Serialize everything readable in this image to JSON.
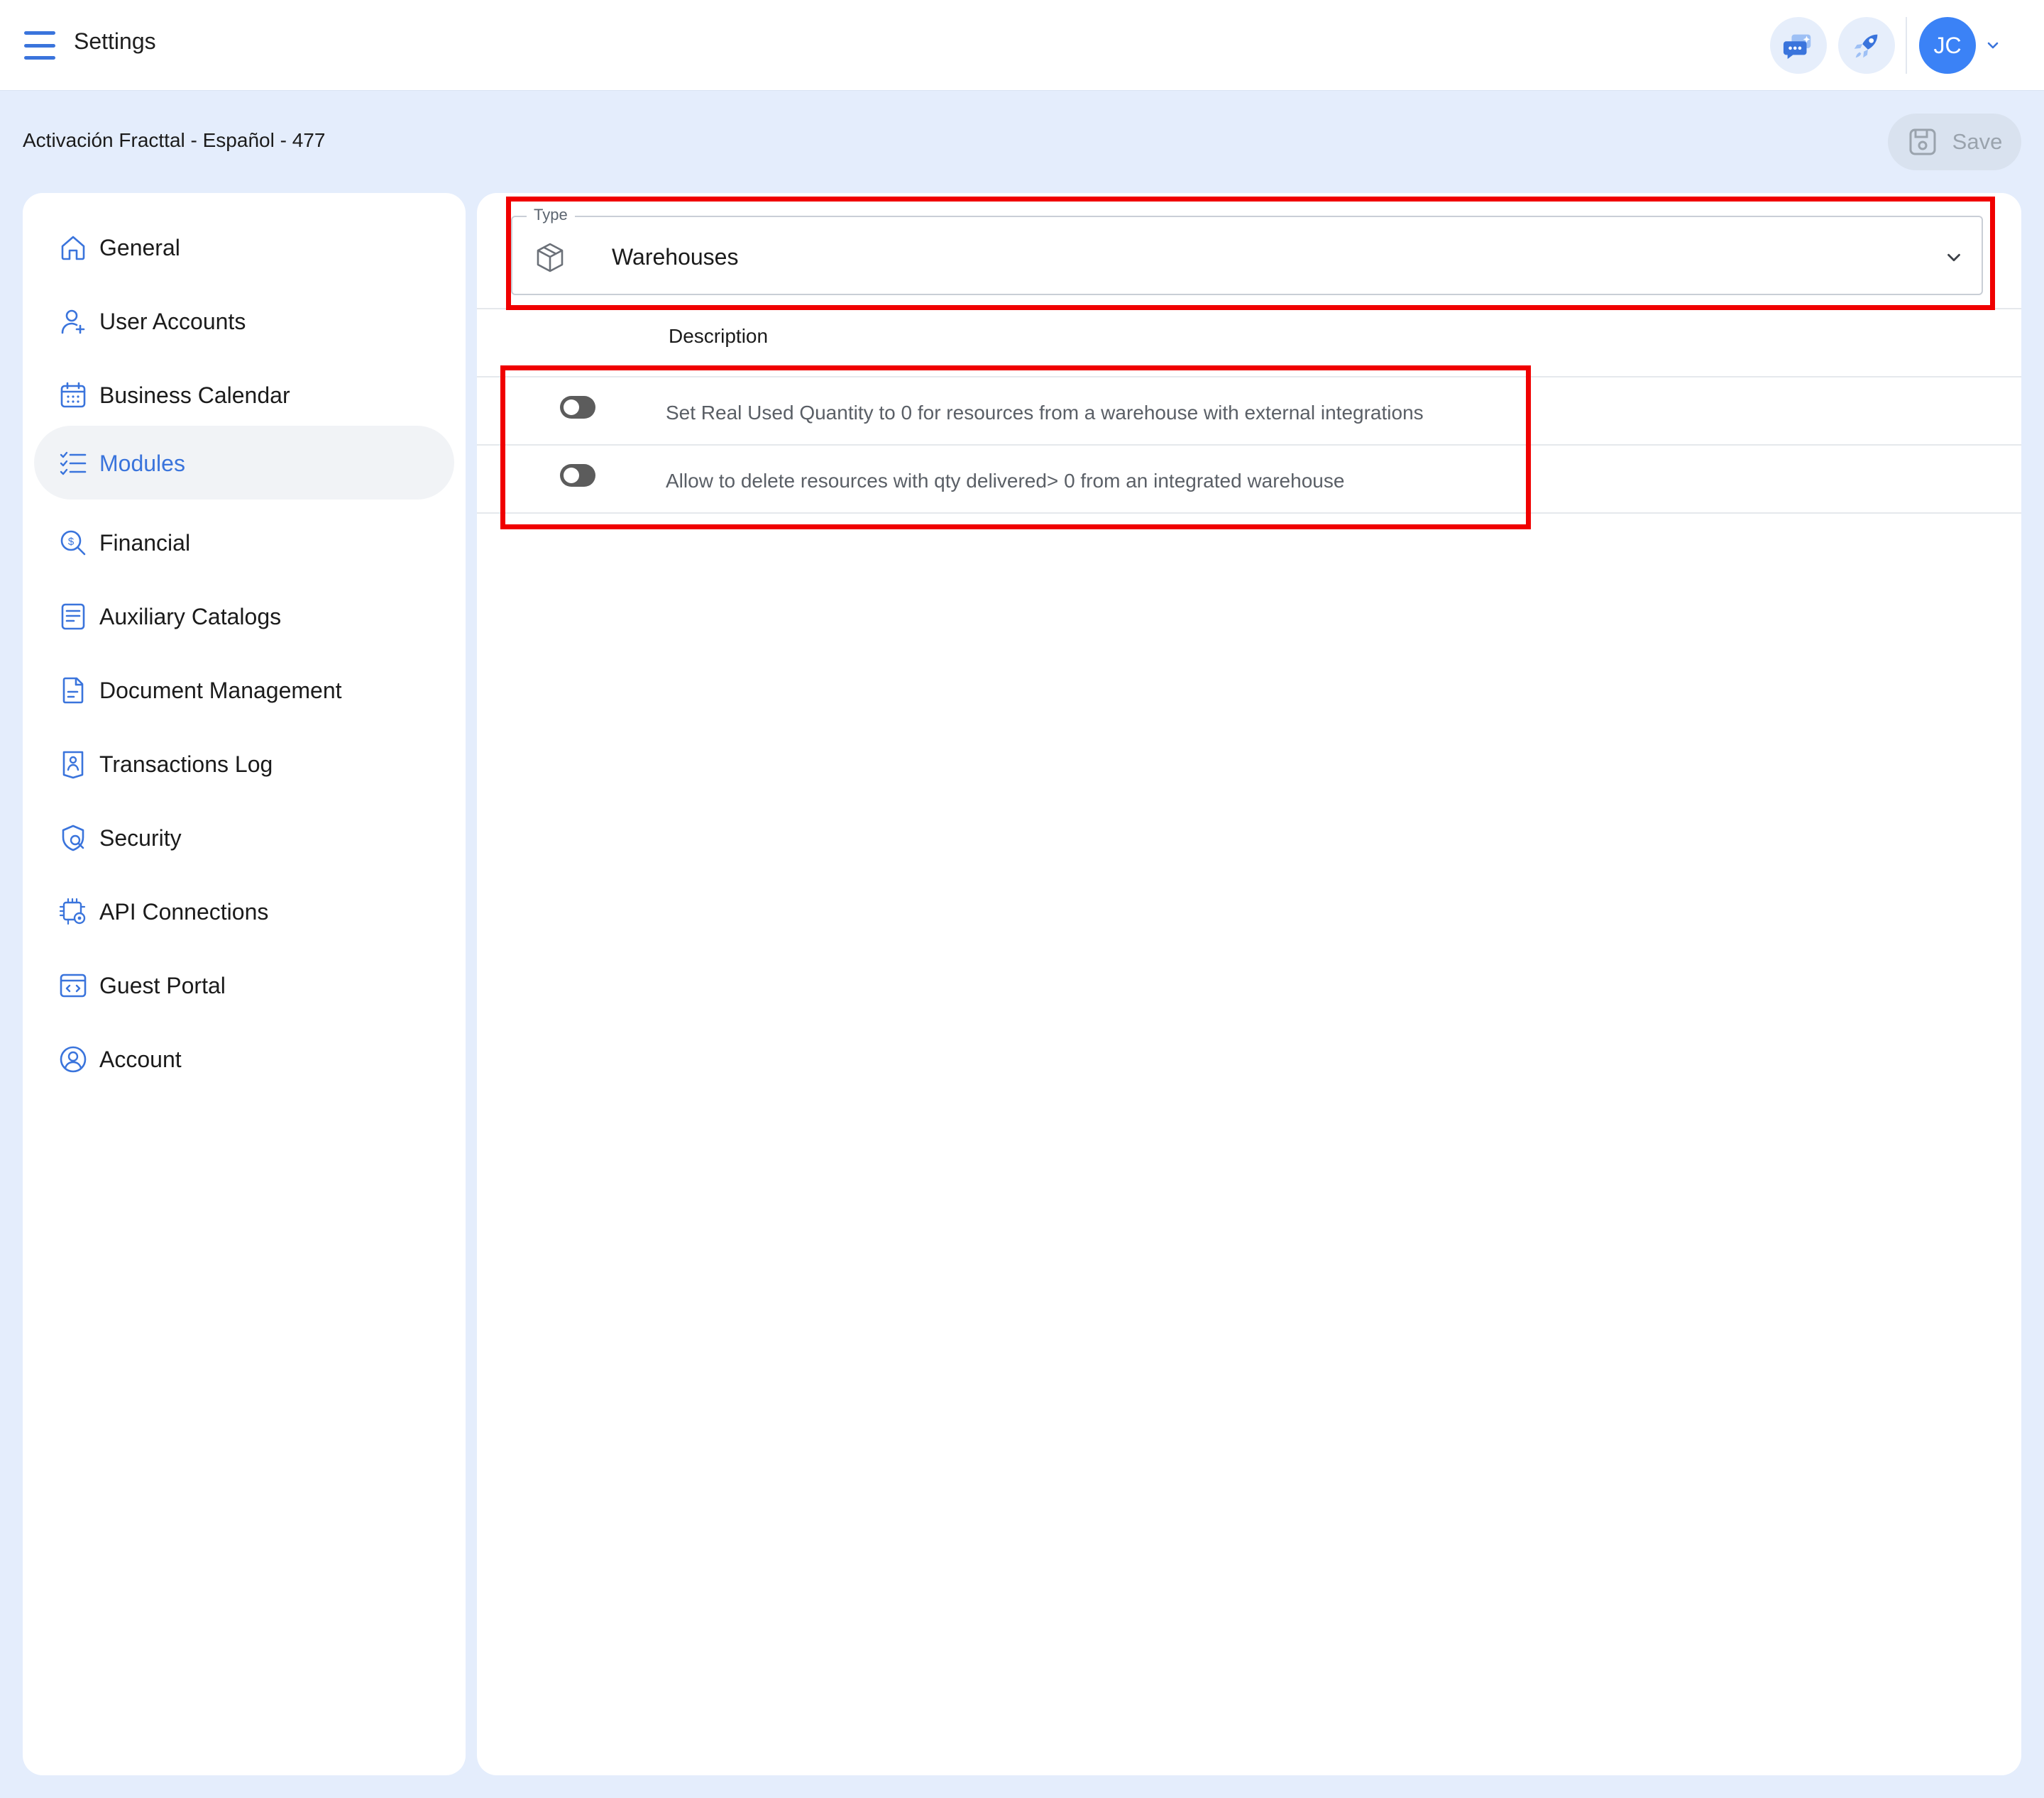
{
  "header": {
    "title": "Settings",
    "menu_icon": "hamburger-menu-icon",
    "chat_icon": "chat-assistant-icon",
    "rocket_icon": "rocket-icon",
    "avatar_initials": "JC"
  },
  "subheader": {
    "account_name": "Activación Fracttal - Español - 477",
    "save_label": "Save",
    "save_enabled": false
  },
  "sidebar": {
    "items": [
      {
        "label": "General",
        "icon": "home-icon",
        "active": false
      },
      {
        "label": "User Accounts",
        "icon": "user-add-icon",
        "active": false
      },
      {
        "label": "Business Calendar",
        "icon": "calendar-icon",
        "active": false
      },
      {
        "label": "Modules",
        "icon": "checklist-icon",
        "active": true
      },
      {
        "label": "Financial",
        "icon": "coin-search-icon",
        "active": false
      },
      {
        "label": "Auxiliary Catalogs",
        "icon": "catalog-icon",
        "active": false
      },
      {
        "label": "Document Management",
        "icon": "document-icon",
        "active": false
      },
      {
        "label": "Transactions Log",
        "icon": "transactions-log-icon",
        "active": false
      },
      {
        "label": "Security",
        "icon": "shield-search-icon",
        "active": false
      },
      {
        "label": "API Connections",
        "icon": "api-gear-icon",
        "active": false
      },
      {
        "label": "Guest Portal",
        "icon": "portal-code-icon",
        "active": false
      },
      {
        "label": "Account",
        "icon": "account-circle-icon",
        "active": false
      }
    ]
  },
  "main": {
    "type_field": {
      "legend": "Type",
      "value": "Warehouses",
      "icon": "box-icon"
    },
    "table": {
      "column_header": "Description",
      "rows": [
        {
          "enabled": false,
          "description": "Set Real Used Quantity to 0 for resources from a warehouse with external integrations"
        },
        {
          "enabled": false,
          "description": "Allow to delete resources with qty delivered> 0 from an integrated warehouse"
        }
      ]
    }
  },
  "colors": {
    "accent": "#3a74dc",
    "page_background": "#e4edfc",
    "highlight": "#f00000",
    "toggle_off": "#5c5c5c"
  }
}
